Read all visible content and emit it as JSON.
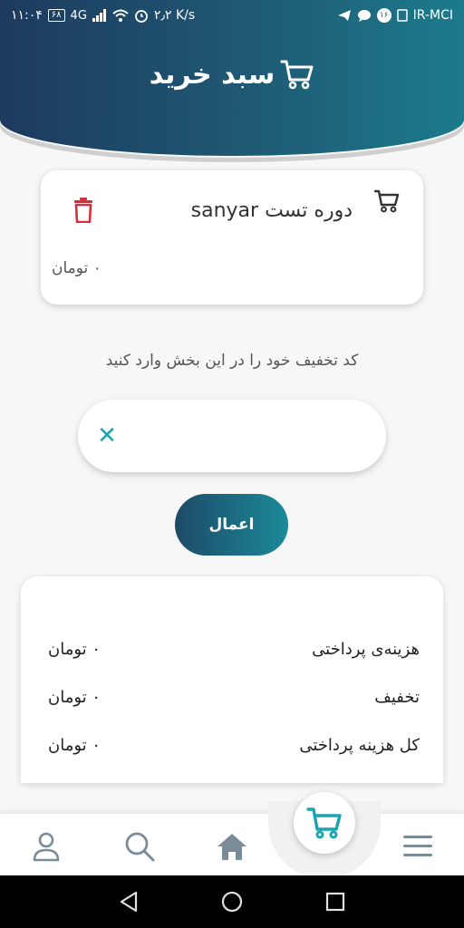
{
  "statusbar": {
    "time": "۱۱:۰۴",
    "battery": "۶۸",
    "network": "4G",
    "speed": "۲٫۲ K/s",
    "notification_count": "۱۶",
    "carrier": "IR-MCI"
  },
  "header": {
    "title": "سبد خرید",
    "icon": "cart-icon"
  },
  "cart_item": {
    "name": "دوره تست sanyar",
    "price": "۰ تومان",
    "icons": [
      "cart-icon",
      "trash-icon"
    ]
  },
  "discount": {
    "label": "کد تخفیف خود را در این بخش وارد کنید",
    "value": "",
    "clear_icon": "close-icon",
    "apply_label": "اعمال"
  },
  "summary": {
    "rows": [
      {
        "label": "هزینه‌ی پرداختی",
        "value": "۰ تومان"
      },
      {
        "label": "تخفیف",
        "value": "۰ تومان"
      },
      {
        "label": "کل هزینه پرداختی",
        "value": "۰ تومان"
      }
    ]
  },
  "bottom_nav": {
    "items": [
      "profile-icon",
      "search-icon",
      "home-icon",
      "cart-icon",
      "menu-icon"
    ]
  },
  "colors": {
    "header_start": "#1d3a5e",
    "header_end": "#1c7b8c",
    "accent": "#1ba4b2",
    "danger": "#d0313a"
  }
}
